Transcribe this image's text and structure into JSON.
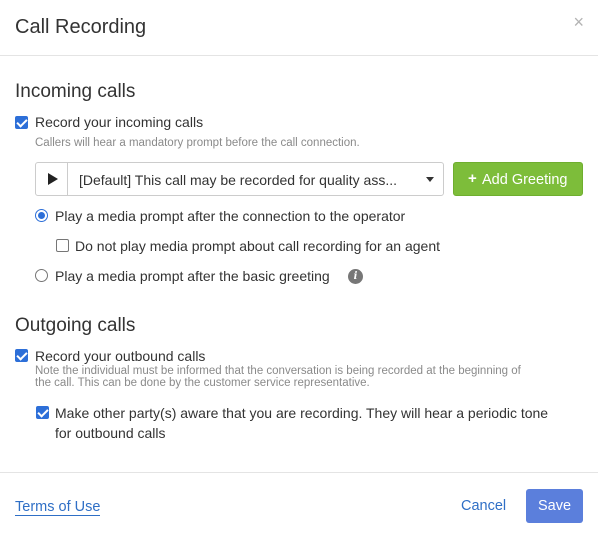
{
  "dialog": {
    "title": "Call Recording",
    "close_symbol": "×"
  },
  "incoming": {
    "section_title": "Incoming calls",
    "record_label": "Record your incoming calls",
    "record_checked": true,
    "hint": "Callers will hear a mandatory prompt before the call connection.",
    "greeting_select_value": "[Default] This call may be recorded for quality ass...",
    "add_greeting_label": "Add Greeting",
    "add_greeting_icon": "plus-icon",
    "option_after_operator_label": "Play a media prompt after the connection to the operator",
    "option_after_operator_selected": true,
    "no_prompt_for_agent_label": "Do not play media prompt about call recording for an agent",
    "no_prompt_for_agent_checked": false,
    "option_after_greeting_label": "Play a media prompt after the basic greeting",
    "option_after_greeting_selected": false,
    "info_icon_glyph": "i"
  },
  "outgoing": {
    "section_title": "Outgoing calls",
    "record_label": "Record your outbound calls",
    "record_checked": true,
    "hint_line1": "Note the individual must be informed that the conversation is being recorded at the beginning of",
    "hint_line2": "the call. This can be done by the customer service representative.",
    "aware_label_line1": "Make other party(s) aware that you are recording. They will hear a periodic tone",
    "aware_label_line2": "for outbound calls",
    "aware_checked": true
  },
  "footer": {
    "terms_label": "Terms of Use",
    "cancel_label": "Cancel",
    "save_label": "Save"
  },
  "colors": {
    "accent_blue": "#2d6fd8",
    "add_greeting_green": "#7dbd3a",
    "save_button": "#5b7fdc",
    "link": "#2f6fc6"
  }
}
